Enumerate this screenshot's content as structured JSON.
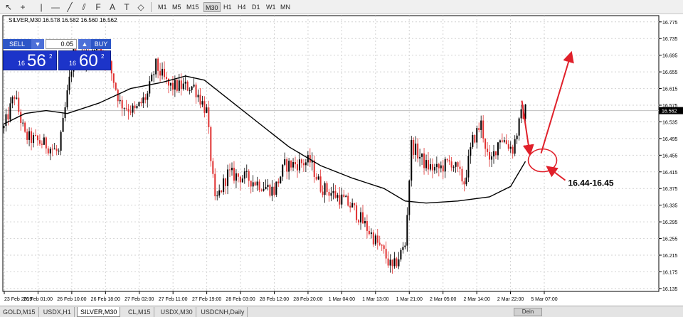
{
  "toolbar": {
    "icons": [
      "cursor-icon",
      "crosshair-icon",
      "vertical-line-icon",
      "horizontal-line-icon",
      "trendline-icon",
      "channel-icon",
      "fibonacci-icon",
      "text-icon",
      "text-label-icon",
      "shapes-icon"
    ],
    "timeframes": [
      "M1",
      "M5",
      "M15",
      "M30",
      "H1",
      "H4",
      "D1",
      "W1",
      "MN"
    ],
    "active_timeframe": "M30"
  },
  "chart": {
    "header": "SILVER,M30  16.578 16.582 16.560 16.562",
    "current_price_label": "16.562",
    "annotation_text": "16.44-16.45",
    "colors": {
      "bull": "#000000",
      "bear": "#e03030",
      "ma": "#000000",
      "annotation": "#e0202a",
      "grid": "#d2d2d2"
    }
  },
  "trade_panel": {
    "sell_label": "SELL",
    "buy_label": "BUY",
    "lot_value": "0.05",
    "sell_prefix": "16",
    "sell_big": "56",
    "sell_sup": "2",
    "buy_prefix": "16",
    "buy_big": "60",
    "buy_sup": "2"
  },
  "chart_data": {
    "type": "candlestick",
    "symbol": "SILVER,M30",
    "ohlc_header": {
      "open": 16.578,
      "high": 16.582,
      "low": 16.56,
      "close": 16.562
    },
    "y_ticks": [
      16.775,
      16.735,
      16.695,
      16.655,
      16.615,
      16.575,
      16.535,
      16.495,
      16.455,
      16.415,
      16.375,
      16.335,
      16.295,
      16.255,
      16.215,
      16.175,
      16.135
    ],
    "ylim": [
      16.128,
      16.79
    ],
    "x_ticks": [
      "23 Feb 2019",
      "26 Feb 01:00",
      "26 Feb 10:00",
      "26 Feb 18:00",
      "27 Feb 02:00",
      "27 Feb 11:00",
      "27 Feb 19:00",
      "28 Feb 03:00",
      "28 Feb 12:00",
      "28 Feb 20:00",
      "1 Mar 04:00",
      "1 Mar 13:00",
      "1 Mar 21:00",
      "2 Mar 05:00",
      "2 Mar 14:00",
      "2 Mar 22:00",
      "5 Mar 07:00"
    ],
    "last_price": 16.562,
    "moving_average_points": [
      {
        "bar": 0,
        "price": 16.53
      },
      {
        "bar": 10,
        "price": 16.555
      },
      {
        "bar": 20,
        "price": 16.562
      },
      {
        "bar": 30,
        "price": 16.555
      },
      {
        "bar": 45,
        "price": 16.58
      },
      {
        "bar": 60,
        "price": 16.615
      },
      {
        "bar": 75,
        "price": 16.63
      },
      {
        "bar": 86,
        "price": 16.645
      },
      {
        "bar": 95,
        "price": 16.635
      },
      {
        "bar": 105,
        "price": 16.595
      },
      {
        "bar": 120,
        "price": 16.535
      },
      {
        "bar": 135,
        "price": 16.475
      },
      {
        "bar": 150,
        "price": 16.43
      },
      {
        "bar": 165,
        "price": 16.4
      },
      {
        "bar": 180,
        "price": 16.375
      },
      {
        "bar": 190,
        "price": 16.345
      },
      {
        "bar": 200,
        "price": 16.34
      },
      {
        "bar": 215,
        "price": 16.345
      },
      {
        "bar": 230,
        "price": 16.355
      },
      {
        "bar": 240,
        "price": 16.38
      },
      {
        "bar": 247,
        "price": 16.44
      }
    ],
    "candle_path": [
      {
        "bar": 0,
        "price": 16.52
      },
      {
        "bar": 5,
        "price": 16.6
      },
      {
        "bar": 10,
        "price": 16.5
      },
      {
        "bar": 20,
        "price": 16.48
      },
      {
        "bar": 26,
        "price": 16.46
      },
      {
        "bar": 30,
        "price": 16.6
      },
      {
        "bar": 33,
        "price": 16.7
      },
      {
        "bar": 40,
        "price": 16.69
      },
      {
        "bar": 45,
        "price": 16.72
      },
      {
        "bar": 50,
        "price": 16.67
      },
      {
        "bar": 55,
        "price": 16.58
      },
      {
        "bar": 62,
        "price": 16.56
      },
      {
        "bar": 68,
        "price": 16.6
      },
      {
        "bar": 72,
        "price": 16.67
      },
      {
        "bar": 78,
        "price": 16.62
      },
      {
        "bar": 90,
        "price": 16.62
      },
      {
        "bar": 96,
        "price": 16.56
      },
      {
        "bar": 100,
        "price": 16.34
      },
      {
        "bar": 106,
        "price": 16.41
      },
      {
        "bar": 115,
        "price": 16.4
      },
      {
        "bar": 128,
        "price": 16.37
      },
      {
        "bar": 133,
        "price": 16.43
      },
      {
        "bar": 145,
        "price": 16.44
      },
      {
        "bar": 150,
        "price": 16.38
      },
      {
        "bar": 160,
        "price": 16.35
      },
      {
        "bar": 165,
        "price": 16.33
      },
      {
        "bar": 172,
        "price": 16.28
      },
      {
        "bar": 180,
        "price": 16.22
      },
      {
        "bar": 184,
        "price": 16.18
      },
      {
        "bar": 190,
        "price": 16.24
      },
      {
        "bar": 193,
        "price": 16.48
      },
      {
        "bar": 200,
        "price": 16.43
      },
      {
        "bar": 205,
        "price": 16.42
      },
      {
        "bar": 212,
        "price": 16.44
      },
      {
        "bar": 218,
        "price": 16.39
      },
      {
        "bar": 222,
        "price": 16.49
      },
      {
        "bar": 226,
        "price": 16.53
      },
      {
        "bar": 230,
        "price": 16.43
      },
      {
        "bar": 235,
        "price": 16.5
      },
      {
        "bar": 241,
        "price": 16.47
      },
      {
        "bar": 245,
        "price": 16.55
      },
      {
        "bar": 247,
        "price": 16.562
      }
    ]
  },
  "tabs": {
    "items": [
      "GOLD,M15",
      "USDX,H1",
      "SILVER,M30",
      "CL,M15",
      "USDX,M30",
      "USDCNH,Daily"
    ],
    "active": "SILVER,M30",
    "scroll_label": "Dein"
  }
}
